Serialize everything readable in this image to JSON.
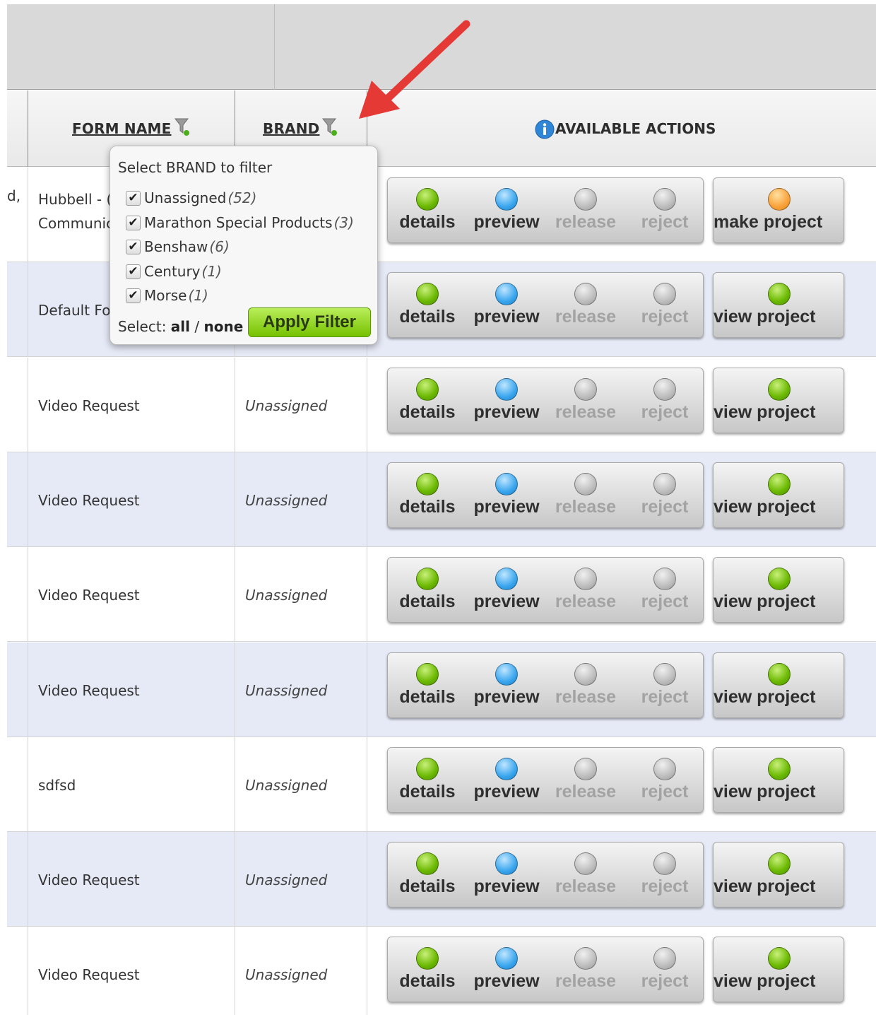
{
  "header": {
    "form_name": "FORM NAME",
    "brand": "BRAND",
    "available_actions": "AVAILABLE ACTIONS"
  },
  "rows": [
    {
      "left_fragment": "d,",
      "form_line1": "Hubbell - (",
      "form_line2": "Communic",
      "brand": "",
      "project_label": "make project",
      "project_status": "orange"
    },
    {
      "left_fragment": "",
      "form_line1": "Default Fo",
      "form_line2": "",
      "brand": "",
      "project_label": "view project",
      "project_status": "green"
    },
    {
      "left_fragment": "",
      "form_line1": "Video Request",
      "form_line2": "",
      "brand": "Unassigned",
      "project_label": "view project",
      "project_status": "green"
    },
    {
      "left_fragment": "",
      "form_line1": "Video Request",
      "form_line2": "",
      "brand": "Unassigned",
      "project_label": "view project",
      "project_status": "green"
    },
    {
      "left_fragment": "",
      "form_line1": "Video Request",
      "form_line2": "",
      "brand": "Unassigned",
      "project_label": "view project",
      "project_status": "green"
    },
    {
      "left_fragment": "",
      "form_line1": "Video Request",
      "form_line2": "",
      "brand": "Unassigned",
      "project_label": "view project",
      "project_status": "green"
    },
    {
      "left_fragment": "",
      "form_line1": "sdfsd",
      "form_line2": "",
      "brand": "Unassigned",
      "project_label": "view project",
      "project_status": "green"
    },
    {
      "left_fragment": "",
      "form_line1": "Video Request",
      "form_line2": "",
      "brand": "Unassigned",
      "project_label": "view project",
      "project_status": "green"
    },
    {
      "left_fragment": "",
      "form_line1": "Video Request",
      "form_line2": "",
      "brand": "Unassigned",
      "project_label": "view project",
      "project_status": "green"
    }
  ],
  "actions": [
    {
      "label": "details",
      "status": "green",
      "enabled": true
    },
    {
      "label": "preview",
      "status": "blue",
      "enabled": true
    },
    {
      "label": "release",
      "status": "grey",
      "enabled": false
    },
    {
      "label": "reject",
      "status": "grey",
      "enabled": false
    }
  ],
  "filter_popup": {
    "title": "Select BRAND to filter",
    "options": [
      {
        "name": "Unassigned",
        "count": "(52)",
        "checked": true
      },
      {
        "name": "Marathon Special Products",
        "count": "(3)",
        "checked": true
      },
      {
        "name": "Benshaw",
        "count": "(6)",
        "checked": true
      },
      {
        "name": "Century",
        "count": "(1)",
        "checked": true
      },
      {
        "name": "Morse",
        "count": "(1)",
        "checked": true
      }
    ],
    "select_prefix": "Select:",
    "select_all": "all",
    "select_separator": "/",
    "select_none": "none",
    "apply_label": "Apply Filter"
  },
  "icons": {
    "filter": "filter-funnel-icon",
    "info": "info-icon",
    "checkbox": "checkmark-icon",
    "annotation": "red-arrow"
  },
  "colors": {
    "green_status": "#6ab800",
    "blue_status": "#3aa6ee",
    "grey_status": "#bdbdbd",
    "orange_status": "#f9a23a",
    "alt_row": "#e6eaf6",
    "apply_button": "#76c100",
    "annotation_arrow": "#e53935"
  }
}
